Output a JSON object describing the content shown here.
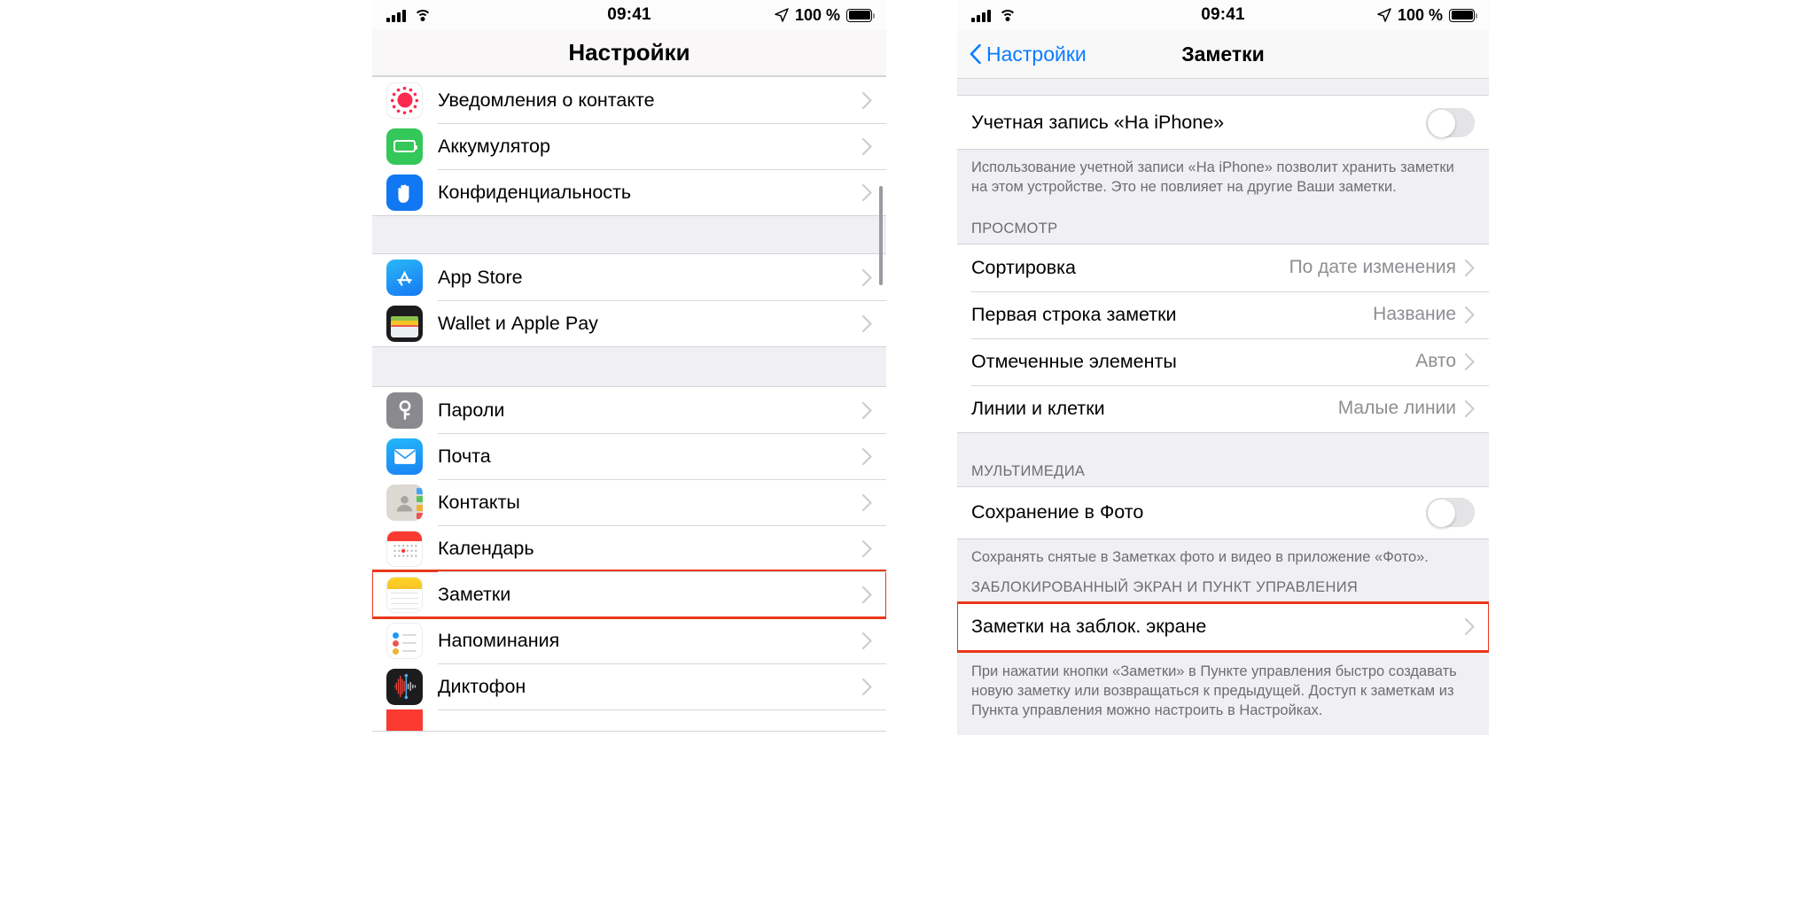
{
  "status_bar": {
    "time": "09:41",
    "battery_percent": "100 %",
    "signal_icon": "cellular-bars-icon",
    "wifi_icon": "wifi-icon",
    "location_icon": "location-arrow-icon",
    "battery_icon": "battery-full-icon"
  },
  "left_screen": {
    "title": "Настройки",
    "groups": [
      {
        "rows": [
          {
            "label": "Уведомления о контакте",
            "icon": "contact-notification-icon",
            "accessory": "chevron-right-icon"
          },
          {
            "label": "Аккумулятор",
            "icon": "battery-app-icon",
            "accessory": "chevron-right-icon"
          },
          {
            "label": "Конфиденциальность",
            "icon": "privacy-hand-icon",
            "accessory": "chevron-right-icon"
          }
        ]
      },
      {
        "rows": [
          {
            "label": "App Store",
            "icon": "app-store-icon",
            "accessory": "chevron-right-icon"
          },
          {
            "label": "Wallet и Apple Pay",
            "icon": "wallet-icon",
            "accessory": "chevron-right-icon"
          }
        ]
      },
      {
        "rows": [
          {
            "label": "Пароли",
            "icon": "passwords-key-icon",
            "accessory": "chevron-right-icon"
          },
          {
            "label": "Почта",
            "icon": "mail-envelope-icon",
            "accessory": "chevron-right-icon"
          },
          {
            "label": "Контакты",
            "icon": "contacts-icon",
            "accessory": "chevron-right-icon"
          },
          {
            "label": "Календарь",
            "icon": "calendar-icon",
            "accessory": "chevron-right-icon"
          },
          {
            "label": "Заметки",
            "icon": "notes-icon",
            "accessory": "chevron-right-icon",
            "highlighted": true
          },
          {
            "label": "Напоминания",
            "icon": "reminders-icon",
            "accessory": "chevron-right-icon"
          },
          {
            "label": "Диктофон",
            "icon": "voice-memos-icon",
            "accessory": "chevron-right-icon"
          }
        ]
      }
    ]
  },
  "right_screen": {
    "back_label": "Настройки",
    "title": "Заметки",
    "account_row": {
      "label": "Учетная запись «На iPhone»",
      "toggle_on": false
    },
    "account_footer": "Использование учетной записи «На iPhone» позволит хранить заметки на этом устройстве. Это не повлияет на другие Ваши заметки.",
    "view_section": {
      "header": "ПРОСМОТР",
      "rows": [
        {
          "label": "Сортировка",
          "value": "По дате изменения",
          "accessory": "chevron-right-icon"
        },
        {
          "label": "Первая строка заметки",
          "value": "Название",
          "accessory": "chevron-right-icon"
        },
        {
          "label": "Отмеченные элементы",
          "value": "Авто",
          "accessory": "chevron-right-icon"
        },
        {
          "label": "Линии и клетки",
          "value": "Малые линии",
          "accessory": "chevron-right-icon"
        }
      ]
    },
    "media_section": {
      "header": "МУЛЬТИМЕДИА",
      "row": {
        "label": "Сохранение в Фото",
        "toggle_on": false
      },
      "footer": "Сохранять снятые в Заметках фото и видео в приложение «Фото»."
    },
    "lock_section": {
      "header": "ЗАБЛОКИРОВАННЫЙ ЭКРАН И ПУНКТ УПРАВЛЕНИЯ",
      "row": {
        "label": "Заметки на заблок. экране",
        "accessory": "chevron-right-icon",
        "highlighted": true
      },
      "footer": "При нажатии кнопки «Заметки» в Пункте управления быстро создавать новую заметку или возвращаться к предыдущей. Доступ к заметкам из Пункта управления можно настроить в Настройках."
    }
  },
  "colors": {
    "accent_blue": "#0a7cff",
    "highlight_red": "#e8381a",
    "group_bg": "#efeff4",
    "secondary_text": "#8e8e93"
  }
}
